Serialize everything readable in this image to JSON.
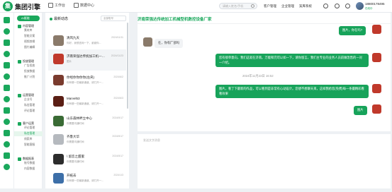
{
  "header": {
    "logo_text": "集团引擎",
    "tabs": [
      {
        "label": "工作台"
      },
      {
        "label": "数据中心"
      }
    ],
    "search_placeholder": "请输入姓名/手机",
    "links": [
      "客户管理",
      "企业管理",
      "案库系统"
    ],
    "user": {
      "phone": "18800178495",
      "status": "在线中"
    }
  },
  "menu": {
    "active_label": "AI赋能",
    "sections": [
      {
        "title": "内容管理",
        "items": [
          "素材库",
          "智能文案",
          "视频剪辑",
          "图片编辑"
        ]
      },
      {
        "title": "投放管理",
        "items": [
          "广告投放",
          "投放数据",
          "推广计划"
        ]
      },
      {
        "title": "运营管理",
        "items": [
          "企业号",
          "私信管理",
          "评论管理"
        ]
      },
      {
        "title": "客户运营",
        "items": [
          "评论管理",
          "私信管理",
          "线索库",
          "智能客服"
        ]
      },
      {
        "title": "数据报表",
        "items": [
          "账号数据",
          "内容数据"
        ]
      }
    ],
    "active_item": "私信管理"
  },
  "list": {
    "title": "最新动态",
    "filter": "全部账号",
    "conversations": [
      {
        "name": "清风九天",
        "date": "2024/11/11",
        "sub": "你好，我想咨询一下，谢谢你..."
      },
      {
        "name": "济南荣强达传统加工机—…",
        "date": "2024/11/23",
        "sub": "图片"
      },
      {
        "name": "你经你你你你(左央)",
        "date": "2024/6/2",
        "sub": "你有哪一些最新通道，请打开一..."
      },
      {
        "name": "Marvel53",
        "date": "2024/6/3",
        "sub": "你有哪一些最新通道，请打开一..."
      },
      {
        "name": "山东森林畔立中心",
        "date": "2024/5/17",
        "sub": "你需要沟通时间"
      },
      {
        "name": "齐鲁大华",
        "date": "2024/5/17",
        "sub": "你需要沟通时间"
      },
      {
        "name": "\\ 留恋之甜蜜",
        "date": "2024/5/17",
        "sub": "你需要沟通时间"
      },
      {
        "name": "开拓去",
        "date": "2024/1/3",
        "sub": "你有哪一些最新通道，请打开一..."
      }
    ]
  },
  "chat": {
    "title": "济南荣强达传统加工机械型机数控设备厂家",
    "messages": [
      {
        "dir": "out",
        "text": "图片，你在吗?"
      },
      {
        "dir": "in",
        "text": "在，你有厂部吗"
      },
      {
        "dir": "out",
        "text": "您有接单意向，我们这就在济南。万能和完可以如一下，请你留言。我们主专业的业务人员前做急售的一对一介绍。"
      },
      {
        "dir": "out",
        "text": "图片，看了下最新的作品，可以看到是非常有心动设计。您想不想聊天来，这样我给您(免费)每一条最精彩看看效果"
      },
      {
        "dir": "out",
        "text": "图片"
      }
    ],
    "timestamp": "2024年11月23日 16:52",
    "composer_placeholder": "发送文字消息"
  },
  "colors": {
    "accent": "#17a35a"
  }
}
